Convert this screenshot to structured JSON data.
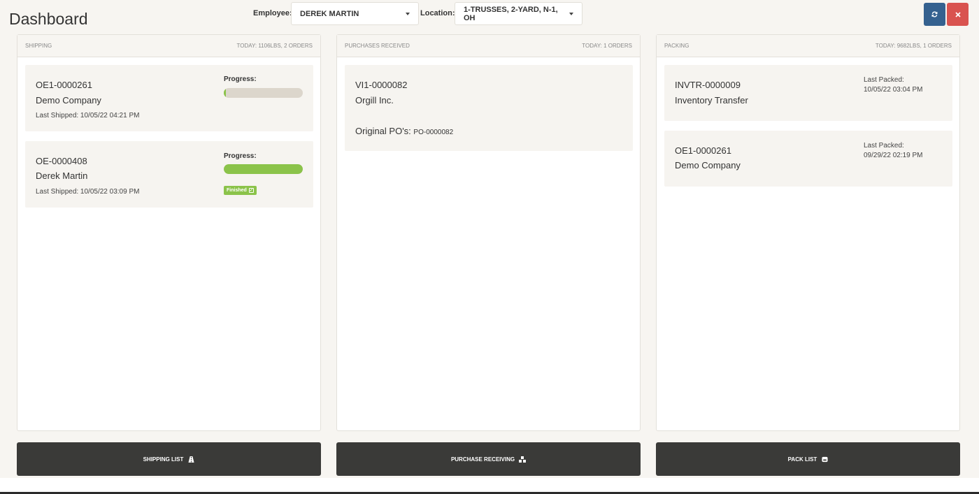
{
  "header": {
    "title": "Dashboard",
    "employee_label": "Employee:",
    "employee_value": "DEREK MARTIN",
    "location_label": "Location:",
    "location_value": "1-TRUSSES, 2-YARD, N-1, OH",
    "refresh_icon": "refresh-icon",
    "close_icon": "close-icon",
    "refresh_color": "#35618f",
    "close_color": "#d9534f"
  },
  "panels": {
    "shipping": {
      "title": "SHIPPING",
      "summary": "TODAY: 1106LBS, 2 ORDERS",
      "cards": [
        {
          "id": "OE1-0000261",
          "name": "Demo Company",
          "meta": "Last Shipped: 10/05/22 04:21 PM",
          "progress_label": "Progress:",
          "progress": 0.03
        },
        {
          "id": "OE-0000408",
          "name": "Derek Martin",
          "meta": "Last Shipped: 10/05/22 03:09 PM",
          "progress_label": "Progress:",
          "progress": 1.0,
          "badge": "Finished"
        }
      ]
    },
    "purchases": {
      "title": "PURCHASES RECEIVED",
      "summary": "TODAY: 1 ORDERS",
      "cards": [
        {
          "id": "VI1-0000082",
          "name": "Orgill Inc.",
          "po_label": "Original PO's:",
          "po_value": "PO-0000082"
        }
      ]
    },
    "packing": {
      "title": "PACKING",
      "summary": "TODAY: 9682LBS, 1 ORDERS",
      "cards": [
        {
          "id": "INVTR-0000009",
          "name": "Inventory Transfer",
          "meta_label": "Last Packed:",
          "meta_value": "10/05/22 03:04 PM"
        },
        {
          "id": "OE1-0000261",
          "name": "Demo Company",
          "meta_label": "Last Packed:",
          "meta_value": "09/29/22 02:19 PM"
        }
      ]
    }
  },
  "buttons": {
    "shipping_list": "SHIPPING LIST",
    "purchase_receiving": "PURCHASE RECEIVING",
    "pack_list": "PACK LIST"
  },
  "colors": {
    "progress": "#8bc34a",
    "button_bg": "#3a3a38"
  }
}
